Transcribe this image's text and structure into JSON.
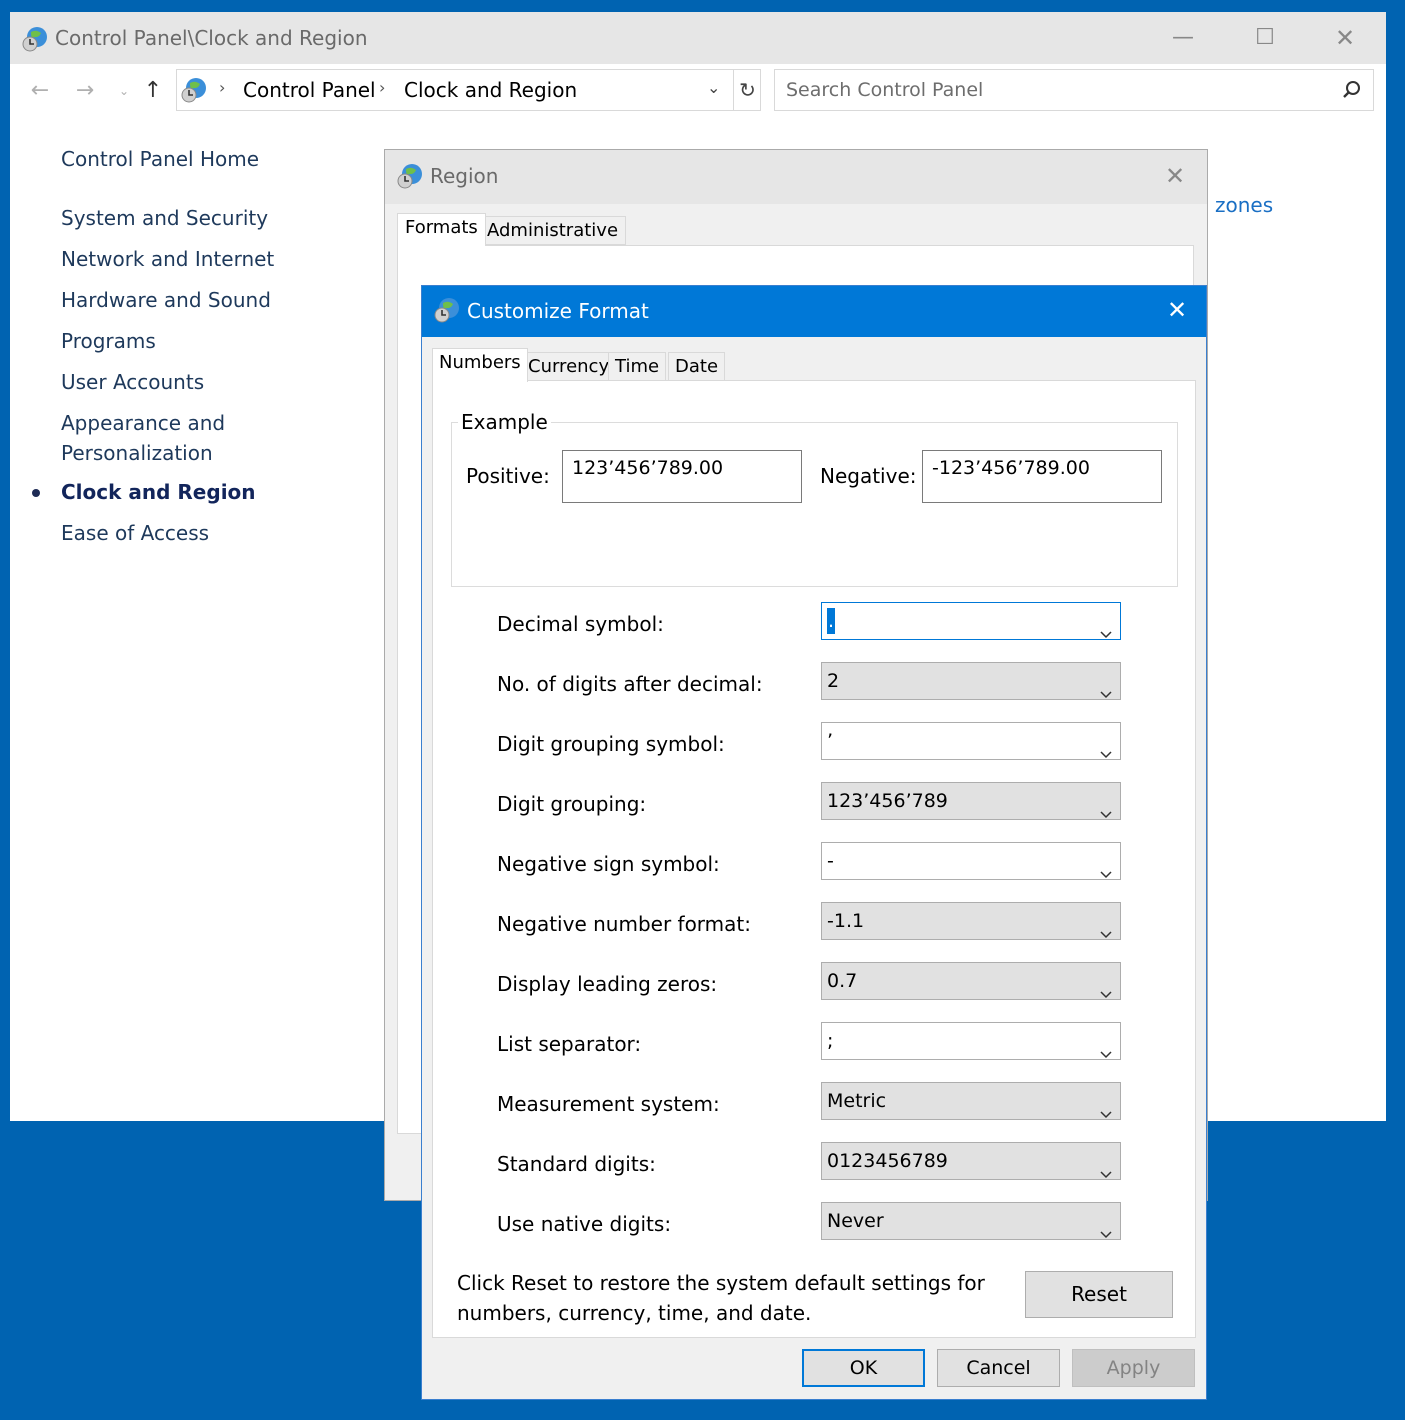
{
  "window": {
    "title": "Control Panel\\Clock and Region",
    "minimize": "—",
    "maximize": "☐",
    "close": "✕"
  },
  "nav": {
    "back": "←",
    "forward": "→",
    "recent": "⌄",
    "up": "↑",
    "breadcrumb_sep": "›",
    "breadcrumb": [
      "Control Panel",
      "Clock and Region"
    ],
    "dropdown": "⌄",
    "refresh": "↻"
  },
  "search": {
    "placeholder": "Search Control Panel"
  },
  "sidebar": {
    "home": "Control Panel Home",
    "items": [
      "System and Security",
      "Network and Internet",
      "Hardware and Sound",
      "Programs",
      "User Accounts",
      "Appearance and Personalization",
      "Clock and Region",
      "Ease of Access"
    ],
    "active_index": 6
  },
  "main": {
    "partial_link": "zones"
  },
  "region_dialog": {
    "title": "Region",
    "close": "✕",
    "tabs": [
      "Formats",
      "Administrative"
    ],
    "active_tab": 0
  },
  "customize_format": {
    "title": "Customize Format",
    "close": "✕",
    "tabs": [
      "Numbers",
      "Currency",
      "Time",
      "Date"
    ],
    "active_tab": 0,
    "example": {
      "legend": "Example",
      "positive_label": "Positive:",
      "positive_value": "123’456’789.00",
      "negative_label": "Negative:",
      "negative_value": "-123’456’789.00"
    },
    "fields": [
      {
        "label": "Decimal symbol:",
        "value": ".",
        "editable": true
      },
      {
        "label": "No. of digits after decimal:",
        "value": "2",
        "editable": false
      },
      {
        "label": "Digit grouping symbol:",
        "value": "’",
        "editable": true
      },
      {
        "label": "Digit grouping:",
        "value": "123’456’789",
        "editable": false
      },
      {
        "label": "Negative sign symbol:",
        "value": "-",
        "editable": true
      },
      {
        "label": "Negative number format:",
        "value": "-1.1",
        "editable": false
      },
      {
        "label": "Display leading zeros:",
        "value": "0.7",
        "editable": false
      },
      {
        "label": "List separator:",
        "value": ";",
        "editable": true
      },
      {
        "label": "Measurement system:",
        "value": "Metric",
        "editable": false
      },
      {
        "label": "Standard digits:",
        "value": "0123456789",
        "editable": false
      },
      {
        "label": "Use native digits:",
        "value": "Never",
        "editable": false
      }
    ],
    "reset_text": "Click Reset to restore the system default settings for numbers, currency, time, and date.",
    "reset_button": "Reset",
    "buttons": {
      "ok": "OK",
      "cancel": "Cancel",
      "apply": "Apply"
    }
  },
  "colors": {
    "desktop": "#0063b1",
    "accent": "#0078d7",
    "sidebar_link": "#1e395b",
    "link": "#1a6fc4"
  },
  "icons": {
    "title": "control-panel-globe-icon",
    "search": "magnifier-icon",
    "chevron": "chevron-down-icon"
  }
}
